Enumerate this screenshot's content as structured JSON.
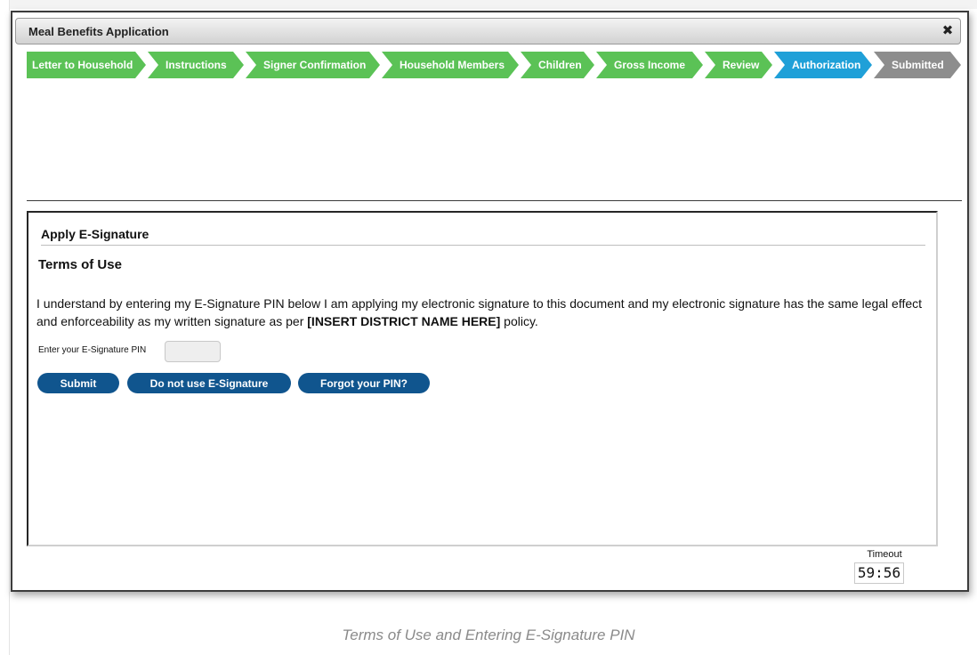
{
  "window": {
    "title": "Meal Benefits Application",
    "close_glyph": "✖"
  },
  "steps": [
    {
      "label": "Letter to Household",
      "state": "complete"
    },
    {
      "label": "Instructions",
      "state": "complete"
    },
    {
      "label": "Signer Confirmation",
      "state": "complete"
    },
    {
      "label": "Household Members",
      "state": "complete"
    },
    {
      "label": "Children",
      "state": "complete"
    },
    {
      "label": "Gross Income",
      "state": "complete"
    },
    {
      "label": "Review",
      "state": "complete"
    },
    {
      "label": "Authorization",
      "state": "current"
    },
    {
      "label": "Submitted",
      "state": "pending"
    }
  ],
  "panel": {
    "header": "Apply E-Signature",
    "terms_heading": "Terms of Use",
    "terms_text_before": "I understand by entering my E-Signature PIN below I am applying my electronic signature to this document and my electronic signature has the same legal effect and enforceability as my written signature as per ",
    "terms_text_bold": "[INSERT DISTRICT NAME HERE]",
    "terms_text_after": " policy.",
    "pin_label": "Enter your E-Signature PIN",
    "pin_value": "",
    "buttons": {
      "submit": "Submit",
      "no_esignature": "Do not use E-Signature",
      "forgot_pin": "Forgot your PIN?"
    }
  },
  "timeout": {
    "label": "Timeout",
    "value": "59:56"
  },
  "caption": "Terms of Use and Entering E-Signature PIN",
  "colors": {
    "step_complete": "#5bc256",
    "step_current": "#1fa0d8",
    "step_pending": "#8d8d8d",
    "button": "#10558e"
  }
}
